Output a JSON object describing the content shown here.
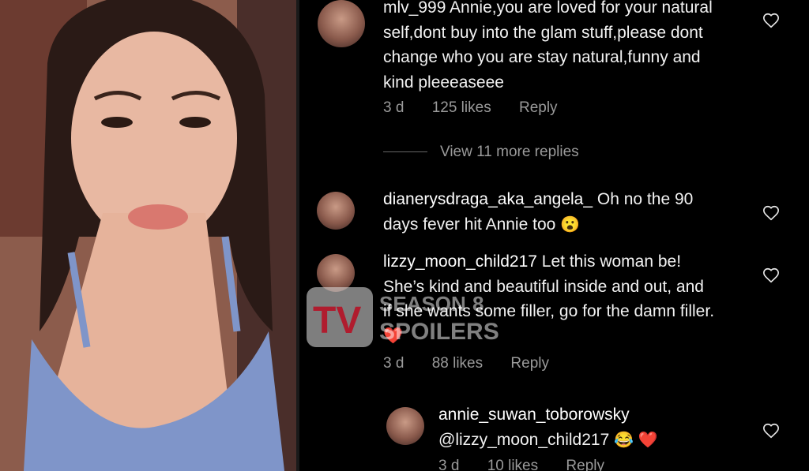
{
  "comments": [
    {
      "username": "mlv_999",
      "text": "Annie,you are loved for your natural self,dont buy into the glam stuff,please dont change who you are stay natural,funny and kind pleeeaseee",
      "line1": "mlv_999 Annie,you are loved for your natural",
      "line2": "self,dont buy into the glam stuff,please dont",
      "line3": "change who you are stay natural,funny and",
      "line4": "kind pleeeaseee",
      "age": "3 d",
      "likes": "125 likes",
      "reply": "Reply"
    },
    {
      "username": "dianerysdraga_aka_angela_",
      "text": "Oh no the 90 days fever hit Annie too",
      "line1_rest": "Oh no the 90",
      "line2": "days fever hit Annie too",
      "emoji": "😮"
    },
    {
      "username": "lizzy_moon_child217",
      "line1_rest": "Let this woman be!",
      "line2": "She’s kind and beautiful inside and out, and",
      "line3": "if she wants some filler, go for the damn filler.",
      "emoji": "❤️",
      "age": "3 d",
      "likes": "88 likes",
      "reply": "Reply"
    },
    {
      "username": "annie_suwan_toborowsky",
      "mention": "@lizzy_moon_child217",
      "emoji": "😂 ❤️",
      "age": "3 d",
      "likes": "10 likes",
      "reply": "Reply"
    }
  ],
  "view_more": "View 11 more replies",
  "watermark": {
    "tv": "TV",
    "season": "SEASON",
    "num": "8",
    "spoilers": "SPOILERS"
  },
  "icons": {
    "heart": "heart-outline-icon"
  },
  "colors": {
    "background": "#000000",
    "text": "#f2f2f2",
    "meta": "#9a9a9a",
    "watermark_red": "#b01c2e"
  }
}
